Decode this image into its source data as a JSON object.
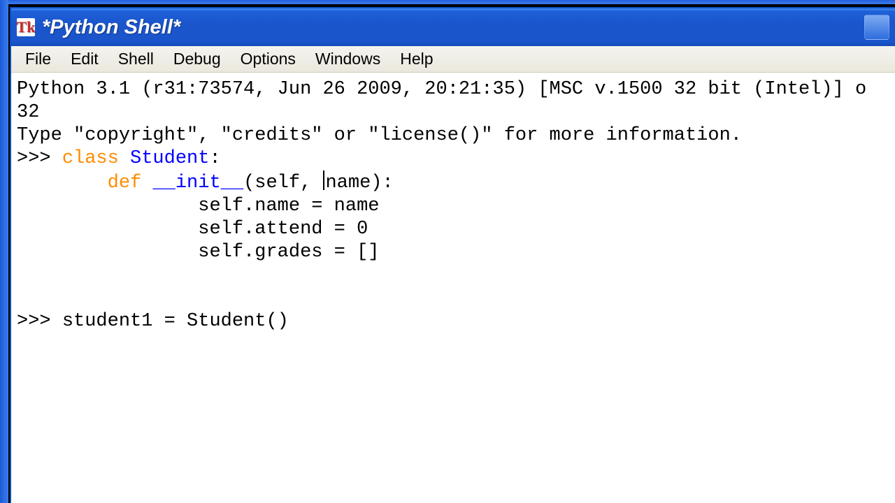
{
  "window": {
    "app_icon_text": "Tk",
    "title": "*Python Shell*"
  },
  "menu": {
    "file": "File",
    "edit": "Edit",
    "shell": "Shell",
    "debug": "Debug",
    "options": "Options",
    "windows": "Windows",
    "help": "Help"
  },
  "shell": {
    "banner1": "Python 3.1 (r31:73574, Jun 26 2009, 20:21:35) [MSC v.1500 32 bit (Intel)] o",
    "banner2": "32",
    "banner3": "Type \"copyright\", \"credits\" or \"license()\" for more information.",
    "p1": ">>> ",
    "l1_kw1": "class",
    "l1_sp": " ",
    "l1_name": "Student",
    "l1_colon": ":",
    "l2_indent": "        ",
    "l2_kw": "def",
    "l2_sp": " ",
    "l2_name": "__init__",
    "l2_args_a": "(self, ",
    "l2_args_b": "name):",
    "l3": "                self.name = name",
    "l4": "                self.attend = 0",
    "l5": "                self.grades = []",
    "blank": "",
    "p2": ">>> ",
    "l6": "student1 = Student()"
  }
}
